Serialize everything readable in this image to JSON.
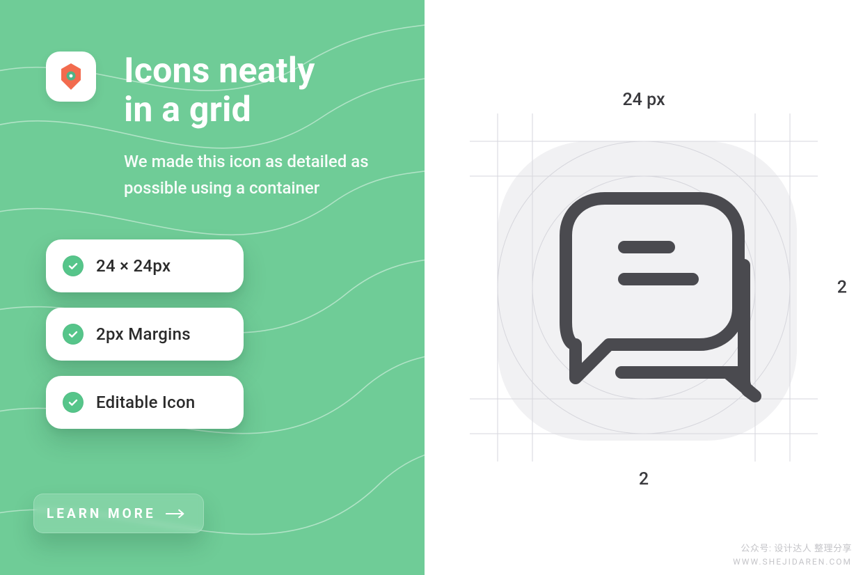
{
  "hero": {
    "title_line1": "Icons neatly",
    "title_line2": "in a grid",
    "subtitle": "We made this icon as detailed as possible using a container"
  },
  "features": [
    {
      "label": "24 × 24px"
    },
    {
      "label": "2px Margins"
    },
    {
      "label": "Editable Icon"
    }
  ],
  "cta": {
    "label": "LEARN MORE"
  },
  "diagram": {
    "top_label": "24 px",
    "right_label": "2",
    "bottom_label": "2"
  },
  "watermark": {
    "line1": "公众号: 设计达人 整理分享",
    "line2": "WWW.SHEJIDAREN.COM"
  },
  "icons": {
    "app_logo": "hexagon-bolt-icon",
    "check": "check-icon",
    "arrow": "arrow-right-icon",
    "chat": "chat-bubbles-icon"
  },
  "colors": {
    "green_bg": "#6fcc97",
    "green_accent": "#56c58a",
    "grey_surface": "#f1f1f3",
    "grey_stroke": "#d6d6dc",
    "icon_stroke": "#4a4a4f"
  }
}
